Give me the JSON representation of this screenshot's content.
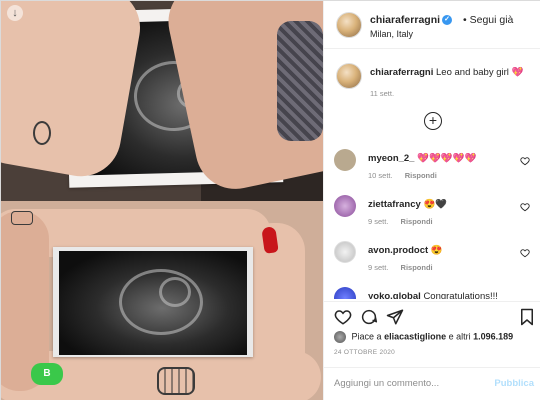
{
  "header": {
    "username": "chiaraferragni",
    "follow_label": "Segui già",
    "separator": "•",
    "location": "Milan, Italy"
  },
  "caption": {
    "username": "chiaraferragni",
    "text": "Leo and baby girl 💖",
    "time": "11 sett."
  },
  "comments": [
    {
      "username": "myeon_2_",
      "text": "💖💖💖💖💖",
      "time": "10 sett.",
      "reply": "Rispondi",
      "avatar_color": "#b9a98f"
    },
    {
      "username": "ziettafrancy",
      "text": "😍🖤",
      "time": "9 sett.",
      "reply": "Rispondi",
      "avatar_color": "#a86fb3"
    },
    {
      "username": "avon.prodoct",
      "text": "😍",
      "time": "9 sett.",
      "reply": "Rispondi",
      "avatar_color": "#d9d9d9"
    },
    {
      "username": "yoko.global",
      "text": "Congratulations!!!",
      "time": "",
      "reply": "",
      "avatar_color": "#3b4fd8"
    }
  ],
  "likes": {
    "prefix": "Piace a",
    "user": "eliacastiglione",
    "middle": "e altri",
    "count": "1.096.189"
  },
  "date": "24 OTTOBRE 2020",
  "add_comment": {
    "placeholder": "Aggiungi un commento...",
    "publish": "Pubblica"
  },
  "media": {
    "badge_text": "B",
    "download_icon": "↓"
  },
  "icons": {
    "verified": "verified-badge-icon",
    "like": "heart-icon",
    "comment": "comment-bubble-icon",
    "share": "paper-plane-icon",
    "save": "bookmark-icon",
    "load_more": "plus-circle-icon"
  },
  "colors": {
    "accent_blue": "#3897f0",
    "publish_disabled": "#b2dffc",
    "text_secondary": "#8e8e8e"
  }
}
